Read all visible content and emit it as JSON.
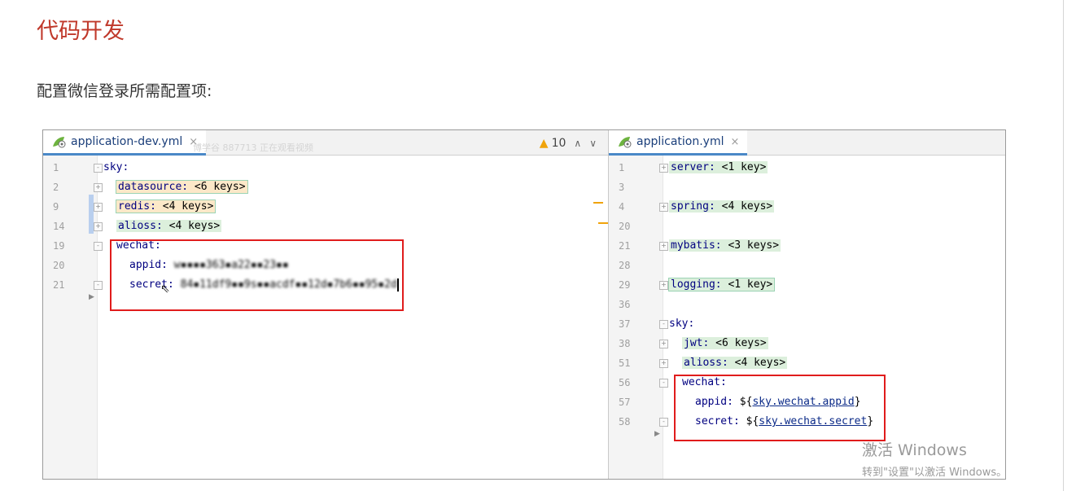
{
  "heading": "代码开发",
  "description": "配置微信登录所需配置项:",
  "left_editor": {
    "tab_label": "application-dev.yml",
    "tab_close": "×",
    "warning_count": "10",
    "watermark": "博学谷 887713 正在观看视频",
    "lines": [
      {
        "num": "1",
        "indent": 0,
        "key": "sky:",
        "value": ""
      },
      {
        "num": "2",
        "indent": 1,
        "key": "datasource:",
        "value": "<6 keys>"
      },
      {
        "num": "9",
        "indent": 1,
        "key": "redis:",
        "value": "<4 keys>"
      },
      {
        "num": "14",
        "indent": 1,
        "key": "alioss:",
        "value": "<4 keys>"
      },
      {
        "num": "19",
        "indent": 1,
        "key": "wechat:",
        "value": ""
      },
      {
        "num": "20",
        "indent": 2,
        "key": "appid:",
        "value": "w▪▪▪▪363▪a22▪▪23▪▪"
      },
      {
        "num": "21",
        "indent": 2,
        "key": "secret:",
        "value": "84▪11df9▪▪9s▪▪acdf▪▪12d▪7b6▪▪95▪2d"
      }
    ]
  },
  "right_editor": {
    "tab_label": "application.yml",
    "tab_close": "×",
    "lines": [
      {
        "num": "1",
        "indent": 0,
        "key": "server:",
        "value": "<1 key>"
      },
      {
        "num": "3",
        "indent": 0,
        "key": "",
        "value": ""
      },
      {
        "num": "4",
        "indent": 0,
        "key": "spring:",
        "value": "<4 keys>"
      },
      {
        "num": "20",
        "indent": 0,
        "key": "",
        "value": ""
      },
      {
        "num": "21",
        "indent": 0,
        "key": "mybatis:",
        "value": "<3 keys>"
      },
      {
        "num": "28",
        "indent": 0,
        "key": "",
        "value": ""
      },
      {
        "num": "29",
        "indent": 0,
        "key": "logging:",
        "value": "<1 key>"
      },
      {
        "num": "36",
        "indent": 0,
        "key": "",
        "value": ""
      },
      {
        "num": "37",
        "indent": 0,
        "key": "sky:",
        "value": ""
      },
      {
        "num": "38",
        "indent": 1,
        "key": "jwt:",
        "value": "<6 keys>"
      },
      {
        "num": "51",
        "indent": 1,
        "key": "alioss:",
        "value": "<4 keys>"
      },
      {
        "num": "56",
        "indent": 1,
        "key": "wechat:",
        "value": ""
      },
      {
        "num": "57",
        "indent": 2,
        "key": "appid:",
        "value": "${sky.wechat.appid}",
        "ref": "sky.wechat.appid"
      },
      {
        "num": "58",
        "indent": 2,
        "key": "secret:",
        "value": "${sky.wechat.secret}",
        "ref": "sky.wechat.secret"
      }
    ]
  },
  "windows_activation": {
    "title": "激活 Windows",
    "subtitle": "转到\"设置\"以激活 Windows。"
  },
  "colors": {
    "heading": "#c0392b",
    "highlight_box": "#e01c1c",
    "tab_underline": "#4a88c7",
    "yaml_key": "#000080",
    "collapsed_bg": "#dcefdc",
    "warning": "#f0a30a"
  }
}
